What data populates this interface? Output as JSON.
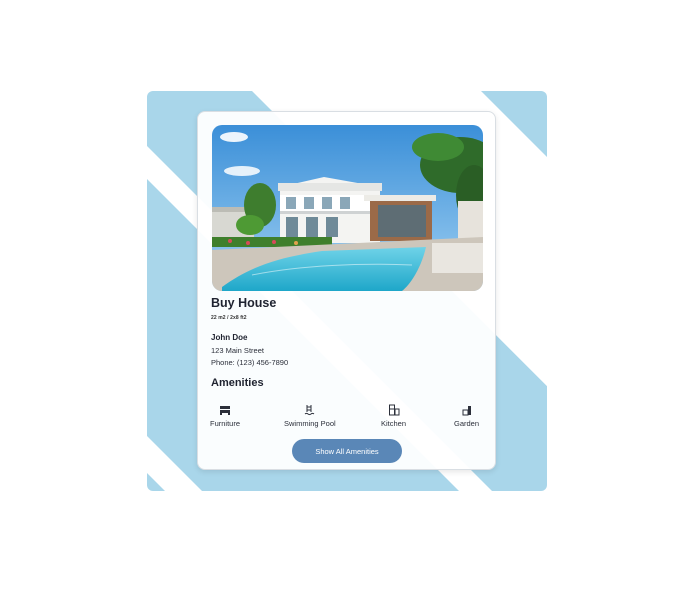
{
  "listing": {
    "title": "Buy House",
    "size_text": "22 m2 / 2x8 ft2",
    "owner": "John Doe",
    "address": "123 Main Street",
    "phone": "Phone: (123) 456-7890"
  },
  "amenities": {
    "heading": "Amenities",
    "items": [
      {
        "label": "Furniture",
        "icon": "sofa-icon"
      },
      {
        "label": "Swimming Pool",
        "icon": "swimming-pool-icon"
      },
      {
        "label": "Kitchen",
        "icon": "kitchen-icon"
      },
      {
        "label": "Garden",
        "icon": "garden-icon"
      }
    ],
    "show_all_label": "Show All Amenities"
  },
  "colors": {
    "accent": "#5a87b7",
    "background_shape": "#a9d6ea"
  }
}
